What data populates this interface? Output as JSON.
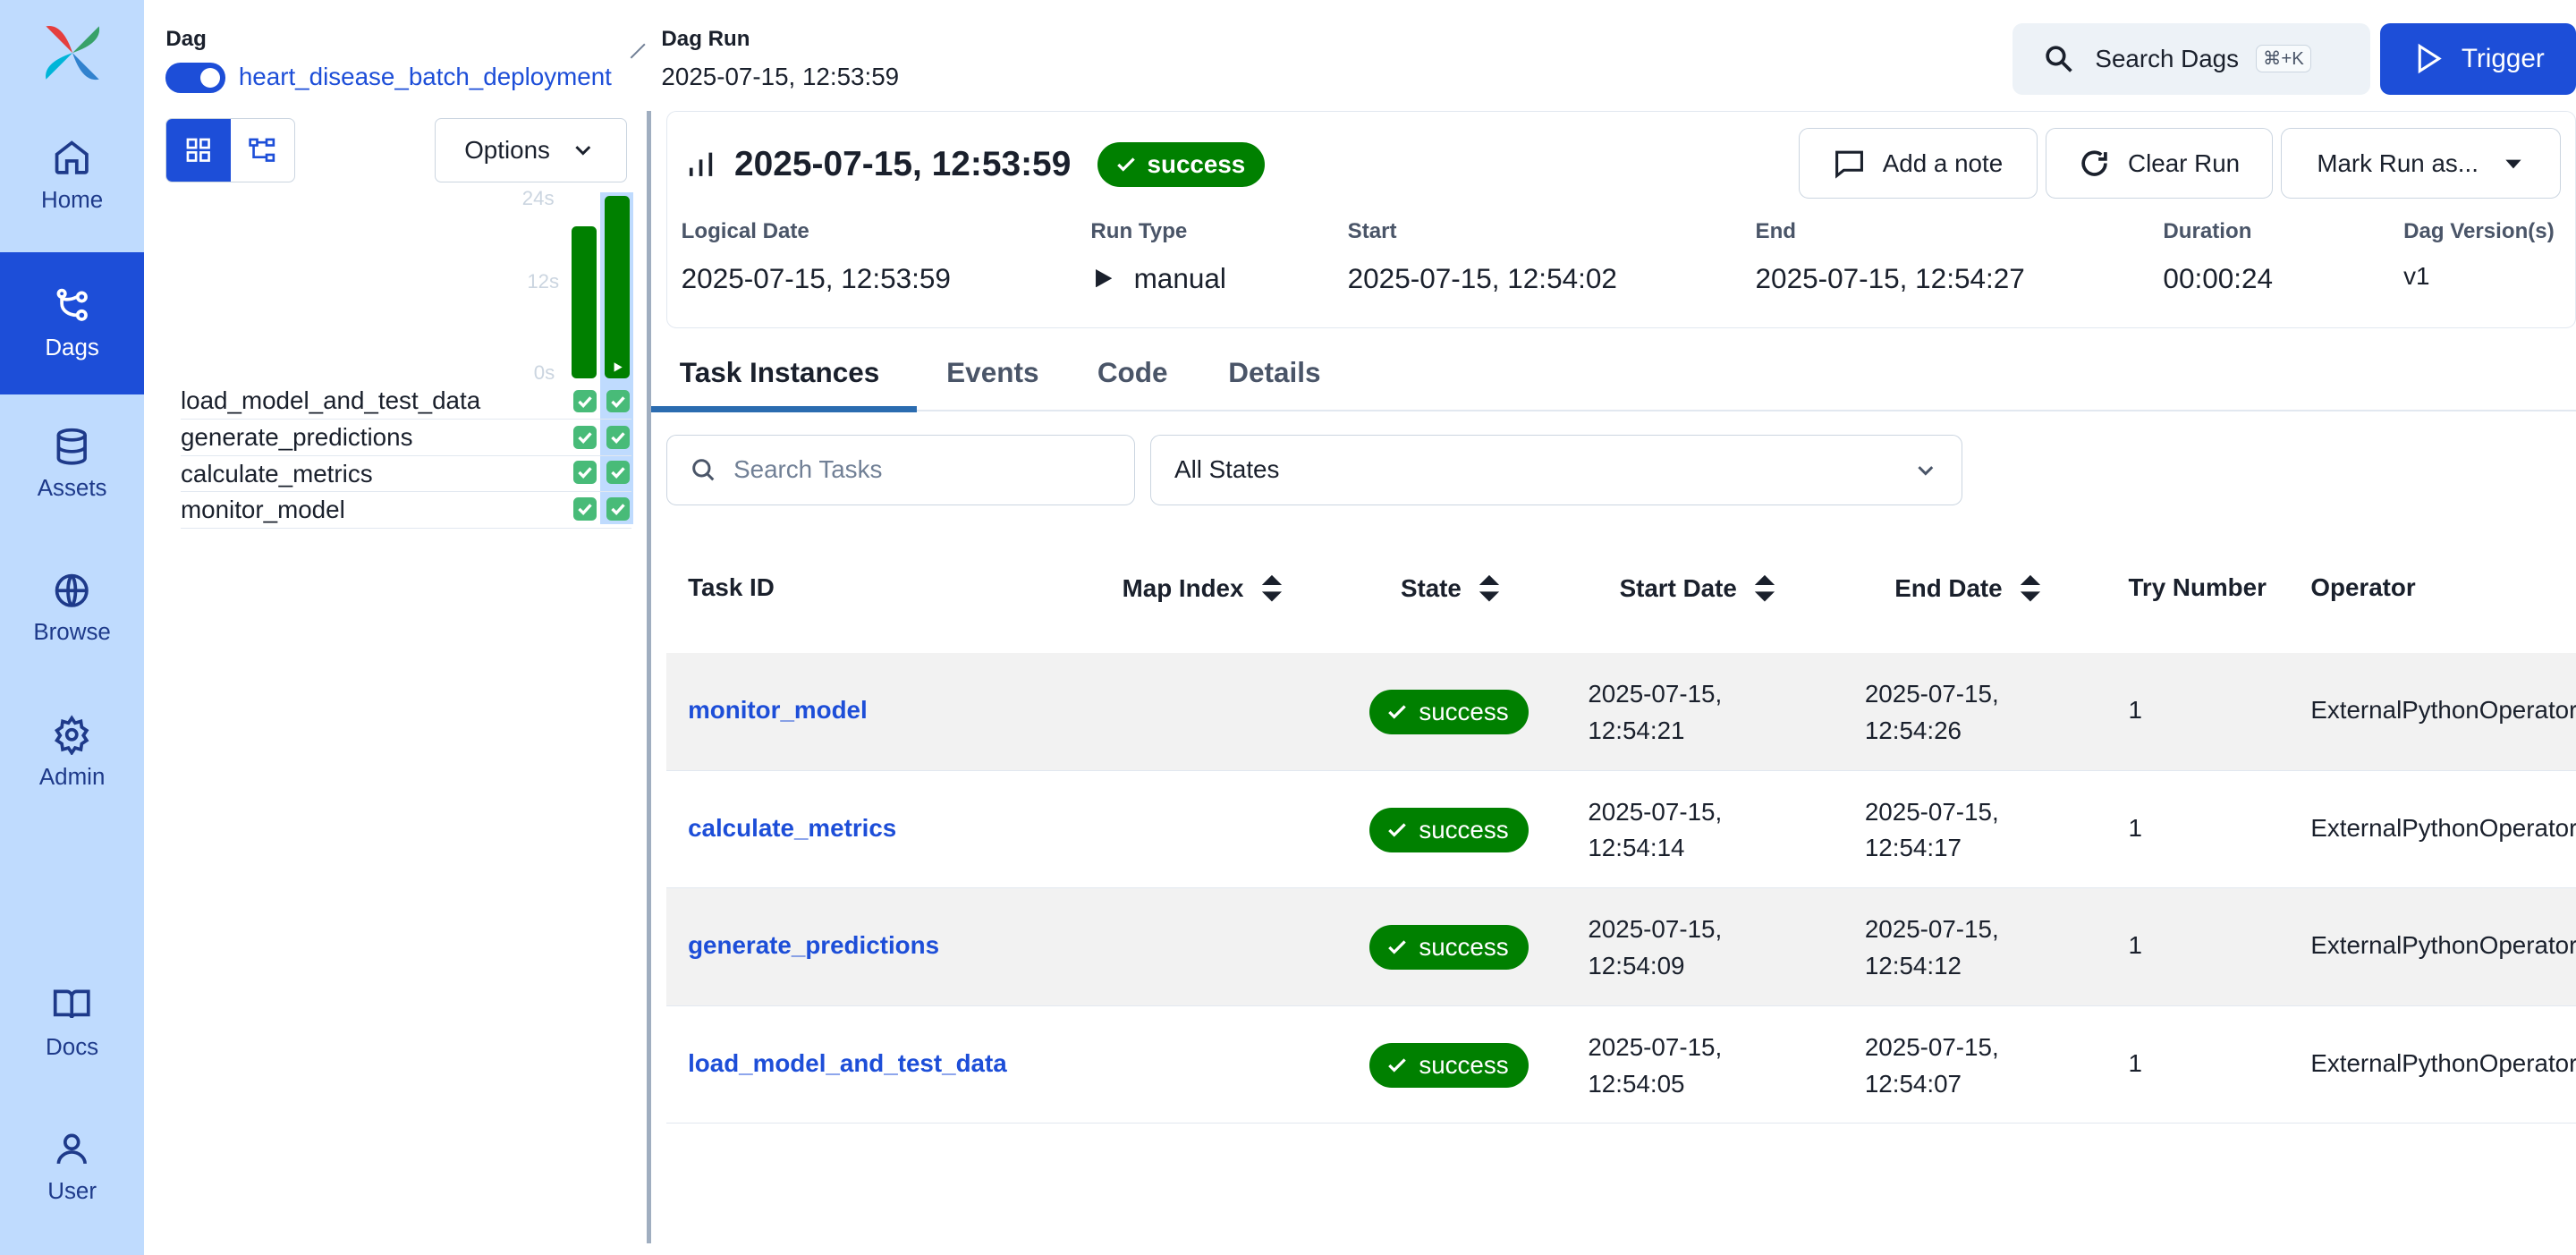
{
  "nav": {
    "items": [
      {
        "label": "Home",
        "icon": "home-icon"
      },
      {
        "label": "Dags",
        "icon": "dags-icon"
      },
      {
        "label": "Assets",
        "icon": "database-icon"
      },
      {
        "label": "Browse",
        "icon": "globe-icon"
      },
      {
        "label": "Admin",
        "icon": "gear-icon"
      },
      {
        "label": "Docs",
        "icon": "book-icon"
      },
      {
        "label": "User",
        "icon": "user-icon"
      }
    ]
  },
  "header": {
    "dag_label": "Dag",
    "dag_name": "heart_disease_batch_deployment",
    "dag_run_label": "Dag Run",
    "dag_run_value": "2025-07-15, 12:53:59",
    "search_label": "Search Dags",
    "search_shortcut": "⌘+K",
    "trigger_label": "Trigger"
  },
  "grid": {
    "options_label": "Options",
    "axis": [
      "24s",
      "12s",
      "0s"
    ],
    "run_durations_s": [
      20,
      24
    ],
    "tasks": [
      "load_model_and_test_data",
      "generate_predictions",
      "calculate_metrics",
      "monitor_model"
    ]
  },
  "run": {
    "title": "2025-07-15, 12:53:59",
    "status": "success",
    "add_note": "Add a note",
    "clear_run": "Clear Run",
    "mark_as": "Mark Run as...",
    "meta": [
      {
        "label": "Logical Date",
        "value": "2025-07-15, 12:53:59"
      },
      {
        "label": "Run Type",
        "value": "manual"
      },
      {
        "label": "Start",
        "value": "2025-07-15, 12:54:02"
      },
      {
        "label": "End",
        "value": "2025-07-15, 12:54:27"
      },
      {
        "label": "Duration",
        "value": "00:00:24"
      },
      {
        "label": "Dag Version(s)",
        "value": "v1"
      }
    ]
  },
  "tabs": [
    "Task Instances",
    "Events",
    "Code",
    "Details"
  ],
  "filters": {
    "search_placeholder": "Search Tasks",
    "state_value": "All States"
  },
  "table": {
    "columns": [
      "Task ID",
      "Map Index",
      "State",
      "Start Date",
      "End Date",
      "Try Number",
      "Operator"
    ],
    "rows": [
      {
        "task_id": "monitor_model",
        "state": "success",
        "start_1": "2025-07-15,",
        "start_2": "12:54:21",
        "end_1": "2025-07-15,",
        "end_2": "12:54:26",
        "try": "1",
        "operator": "ExternalPythonOperator"
      },
      {
        "task_id": "calculate_metrics",
        "state": "success",
        "start_1": "2025-07-15,",
        "start_2": "12:54:14",
        "end_1": "2025-07-15,",
        "end_2": "12:54:17",
        "try": "1",
        "operator": "ExternalPythonOperator"
      },
      {
        "task_id": "generate_predictions",
        "state": "success",
        "start_1": "2025-07-15,",
        "start_2": "12:54:09",
        "end_1": "2025-07-15,",
        "end_2": "12:54:12",
        "try": "1",
        "operator": "ExternalPythonOperator"
      },
      {
        "task_id": "load_model_and_test_data",
        "state": "success",
        "start_1": "2025-07-15,",
        "start_2": "12:54:05",
        "end_1": "2025-07-15,",
        "end_2": "12:54:07",
        "try": "1",
        "operator": "ExternalPythonOperator"
      }
    ]
  },
  "colors": {
    "accent": "#1d4ed8",
    "nav_bg": "#bfdbfe",
    "success": "#008000"
  }
}
